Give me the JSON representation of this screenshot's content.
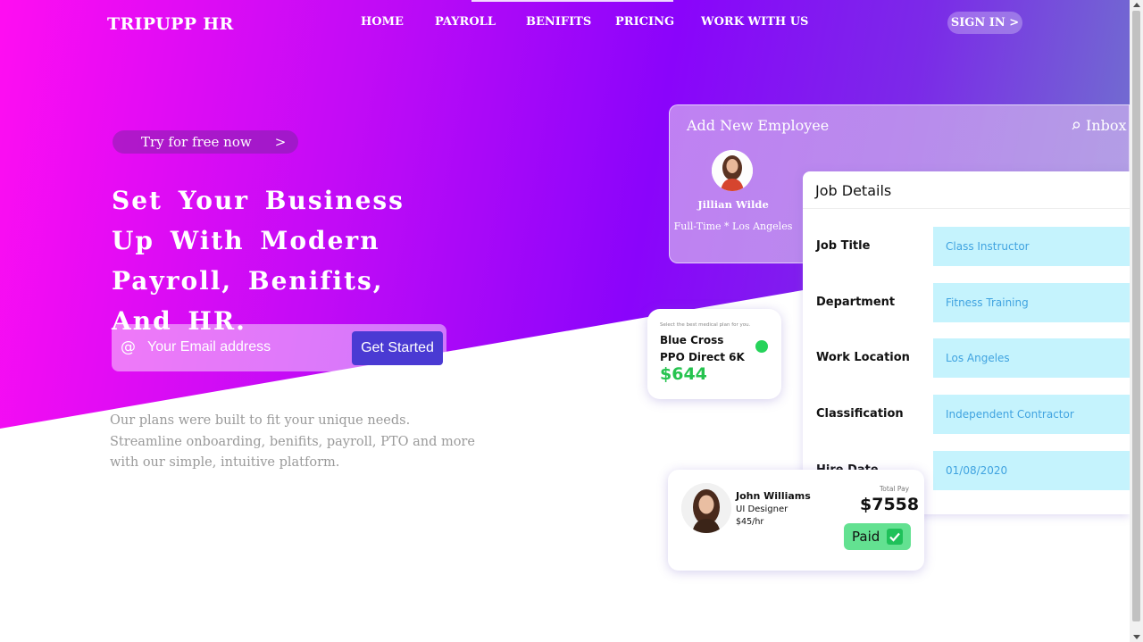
{
  "brand": {
    "logo": "TRIPUPP HR"
  },
  "nav": {
    "items": [
      {
        "label": "HOME"
      },
      {
        "label": "PAYROLL"
      },
      {
        "label": "BENIFITS"
      },
      {
        "label": "PRICING"
      },
      {
        "label": "WORK WITH US"
      }
    ],
    "signin": "SIGN IN >"
  },
  "hero": {
    "try_label": "Try for free now",
    "try_chevron": ">",
    "headline": "Set Your Business Up With Modern Payroll, Benifits, And HR.",
    "email_icon": "@",
    "email_placeholder": "Your Email address",
    "cta": "Get Started",
    "description": "Our plans were built to fit your unique needs. Streamline onboarding, benifits, payroll, PTO and more with our simple, intuitive platform."
  },
  "add_employee": {
    "title": "Add New Employee",
    "inbox": "Inbox",
    "name": "Jillian Wilde",
    "subtitle": "Full-Time * Los Angeles"
  },
  "job_details": {
    "title": "Job Details",
    "rows": [
      {
        "label": "Job Title",
        "value": "Class Instructor"
      },
      {
        "label": "Department",
        "value": "Fitness Training"
      },
      {
        "label": "Work Location",
        "value": "Los Angeles"
      },
      {
        "label": "Classification",
        "value": "Independent Contractor"
      },
      {
        "label": "Hire Date",
        "value": "01/08/2020"
      }
    ]
  },
  "plan_card": {
    "hint": "Select the best medical plan for you.",
    "name_line1": "Blue Cross",
    "name_line2": "PPO Direct 6K",
    "price": "$644"
  },
  "pay_card": {
    "name": "John Williams",
    "role": "UI Designer",
    "rate": "$45/hr",
    "total_label": "Total Pay",
    "total": "$7558",
    "status": "Paid"
  },
  "colors": {
    "gradient_start": "#ff0df2",
    "gradient_mid": "#8a04fb",
    "gradient_end": "#6d86c7",
    "cta": "#4a3ad3",
    "job_value_bg": "#c5f3fd",
    "job_value_text": "#40a3e0",
    "price_green": "#26c34f",
    "paid_green": "#63e191"
  }
}
